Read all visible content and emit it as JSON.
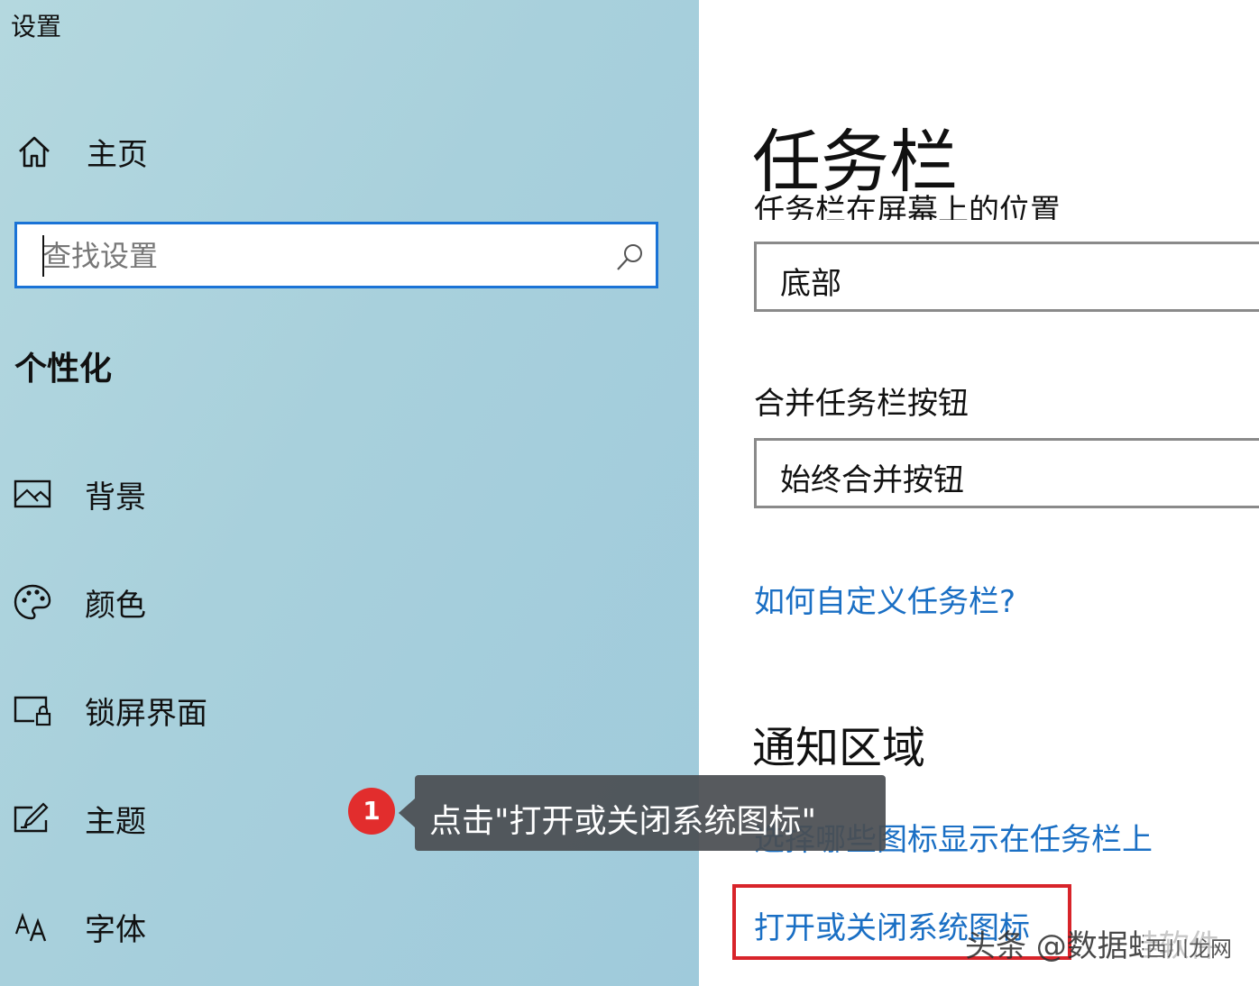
{
  "app": {
    "title": "设置"
  },
  "sidebar": {
    "home": {
      "label": "主页",
      "icon": "home-icon"
    },
    "search": {
      "placeholder": "查找设置",
      "icon": "search-icon"
    },
    "section_heading": "个性化",
    "items": [
      {
        "label": "背景",
        "icon": "picture-icon"
      },
      {
        "label": "颜色",
        "icon": "palette-icon"
      },
      {
        "label": "锁屏界面",
        "icon": "lock-screen-icon"
      },
      {
        "label": "主题",
        "icon": "theme-icon"
      },
      {
        "label": "字体",
        "icon": "font-icon"
      }
    ]
  },
  "main": {
    "title": "任务栏",
    "position_label": "任务栏在屏幕上的位置",
    "position_value": "底部",
    "combine_label": "合并任务栏按钮",
    "combine_value": "始终合并按钮",
    "customize_link": "如何自定义任务栏?",
    "notification_heading": "通知区域",
    "select_icons_link": "选择哪些图标显示在任务栏上",
    "toggle_system_icons_link": "打开或关闭系统图标"
  },
  "annotation": {
    "step_number": "1",
    "tooltip_text": "点击\"打开或关闭系统图标\"",
    "highlight_color": "#d8242a"
  },
  "watermark": {
    "text": "头条 @数据蛙软件",
    "site": "西川龙网"
  },
  "colors": {
    "accent": "#1a73d6",
    "link": "#1a6fc4",
    "sidebar_bg": "#a8d0dc"
  }
}
